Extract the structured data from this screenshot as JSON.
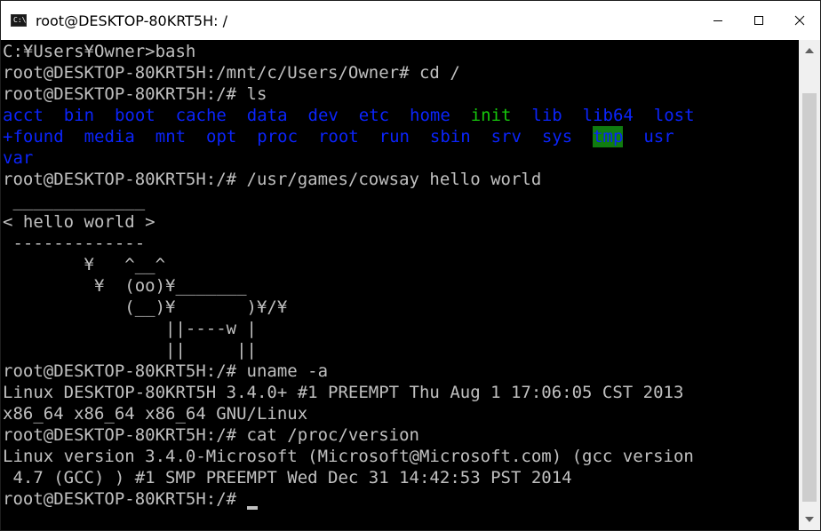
{
  "window": {
    "title": "root@DESKTOP-80KRT5H: /",
    "icon": "console-icon",
    "icon_glyph": "C:\\"
  },
  "terminal": {
    "lines": [
      "C:¥Users¥Owner>bash",
      "root@DESKTOP-80KRT5H:/mnt/c/Users/Owner# cd /",
      "root@DESKTOP-80KRT5H:/# ls",
      {
        "ls": [
          {
            "name": "acct",
            "col": 0,
            "color": "blue"
          },
          {
            "name": "bin",
            "col": 6,
            "color": "blue"
          },
          {
            "name": "boot",
            "col": 11,
            "color": "blue"
          },
          {
            "name": "cache",
            "col": 17,
            "color": "blue"
          },
          {
            "name": "data",
            "col": 24,
            "color": "blue"
          },
          {
            "name": "dev",
            "col": 30,
            "color": "blue"
          },
          {
            "name": "etc",
            "col": 35,
            "color": "blue"
          },
          {
            "name": "home",
            "col": 40,
            "color": "blue"
          },
          {
            "name": "init",
            "col": 46,
            "color": "green"
          },
          {
            "name": "lib",
            "col": 52,
            "color": "blue"
          },
          {
            "name": "lib64",
            "col": 57,
            "color": "blue"
          },
          {
            "name": "lost",
            "col": 64,
            "color": "blue"
          }
        ]
      },
      {
        "ls": [
          {
            "name": "+found",
            "col": 0,
            "color": "blue"
          },
          {
            "name": "media",
            "col": 8,
            "color": "blue"
          },
          {
            "name": "mnt",
            "col": 15,
            "color": "blue"
          },
          {
            "name": "opt",
            "col": 20,
            "color": "blue"
          },
          {
            "name": "proc",
            "col": 25,
            "color": "blue"
          },
          {
            "name": "root",
            "col": 31,
            "color": "blue"
          },
          {
            "name": "run",
            "col": 37,
            "color": "blue"
          },
          {
            "name": "sbin",
            "col": 42,
            "color": "blue"
          },
          {
            "name": "srv",
            "col": 48,
            "color": "blue"
          },
          {
            "name": "sys",
            "col": 53,
            "color": "blue"
          },
          {
            "name": "tmp",
            "col": 58,
            "color": "tmp"
          },
          {
            "name": "usr",
            "col": 63,
            "color": "blue"
          }
        ]
      },
      {
        "ls": [
          {
            "name": "var",
            "col": 0,
            "color": "blue"
          }
        ]
      },
      "root@DESKTOP-80KRT5H:/# /usr/games/cowsay hello world",
      " _____________",
      "< hello world >",
      " -------------",
      "        ¥   ^__^",
      "         ¥  (oo)¥_______",
      "            (__)¥       )¥/¥",
      "                ||----w |",
      "                ||     ||",
      "root@DESKTOP-80KRT5H:/# uname -a",
      "Linux DESKTOP-80KRT5H 3.4.0+ #1 PREEMPT Thu Aug 1 17:06:05 CST 2013",
      "x86_64 x86_64 x86_64 GNU/Linux",
      "root@DESKTOP-80KRT5H:/# cat /proc/version",
      "Linux version 3.4.0-Microsoft (Microsoft@Microsoft.com) (gcc version",
      " 4.7 (GCC) ) #1 SMP PREEMPT Wed Dec 31 14:42:53 PST 2014",
      {
        "prompt": "root@DESKTOP-80KRT5H:/# ",
        "cursor": true
      }
    ]
  },
  "colors": {
    "background": "#000000",
    "foreground": "#c0c0c0",
    "dir_blue": "#0b24fb",
    "exec_green": "#16c60c",
    "tmp_bg": "#107c10",
    "scrollbar_track": "#f0f0f0",
    "scrollbar_thumb": "#cdcdcd"
  }
}
